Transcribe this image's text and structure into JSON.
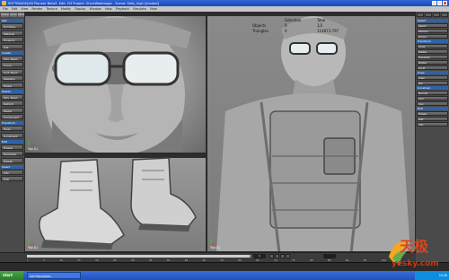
{
  "window": {
    "title": "SOFTIMAGE|XSI Pioneer Beta3 -Edit- D3 Project: ShortWebImage - Scene: Selly_high [shaded]"
  },
  "menu": {
    "items": [
      "File",
      "Edit",
      "View",
      "Render",
      "Texture",
      "Modify",
      "Display",
      "Window",
      "Help",
      "Playback",
      "Simulate",
      "View"
    ]
  },
  "left_panel": {
    "tabs": [
      "Model",
      "Anim",
      "Render"
    ],
    "sections": [
      {
        "header": "Get",
        "buttons": [
          "Primitive",
          "Material",
          "Property",
          "Get"
        ]
      },
      {
        "header": "Create",
        "buttons": [
          "Poly. Mesh",
          "Curve",
          "Surf. Mesh",
          "Skeleton",
          "Model"
        ]
      },
      {
        "header": "Modify",
        "buttons": [
          "Poly. Mesh",
          "Deform",
          "Model",
          "Component"
        ]
      },
      {
        "header": "Transform",
        "buttons": [
          "Tools",
          "Constraint"
        ]
      },
      {
        "header": "Edit",
        "buttons": [
          "Freeze",
          "Duplicate",
          "Delete"
        ]
      },
      {
        "header": "Select",
        "buttons": [
          "Info",
          "Edit"
        ]
      }
    ]
  },
  "right_panel": {
    "sections": [
      {
        "header": "Select",
        "buttons": [
          "Select",
          "Explore",
          "Group"
        ]
      },
      {
        "header": "Transform",
        "buttons": [
          "Scale",
          "Rotate",
          "Translate",
          "Global",
          "Local"
        ]
      },
      {
        "header": "Snap",
        "buttons": [
          "Snap",
          "Ref"
        ]
      },
      {
        "header": "Constrain",
        "buttons": [
          "Normal",
          "Sym",
          "Cog"
        ]
      },
      {
        "header": "Edit",
        "buttons": [
          "Freeze",
          "Edit",
          "Info"
        ]
      }
    ]
  },
  "viewports": {
    "top_left": {
      "name": "Top-Left",
      "label": "Top (L)"
    },
    "bottom_left": {
      "name": "Bottom-Left",
      "label": "Top (L)"
    },
    "right": {
      "name": "Right",
      "label": "Top (L)"
    }
  },
  "stats": {
    "headers": [
      "",
      "Selection",
      "Total"
    ],
    "rows": [
      [
        "Objects",
        "0",
        "1/2"
      ],
      [
        "Triangles",
        "0",
        "114873.797"
      ]
    ]
  },
  "timeline": {
    "ticks": [
      "1",
      "5",
      "10",
      "15",
      "20",
      "25",
      "30",
      "35",
      "40",
      "45",
      "50",
      "55",
      "60",
      "65",
      "70",
      "75",
      "80",
      "85",
      "90",
      "95",
      "100"
    ],
    "current_frame": "1",
    "progress": 0.99
  },
  "taskbar": {
    "start_label": "start",
    "tasks": [
      "SOFTIMAGE|XSI..."
    ],
    "clock": "10:28"
  },
  "watermark": {
    "cn": "天极",
    "url": "yesky.com"
  }
}
